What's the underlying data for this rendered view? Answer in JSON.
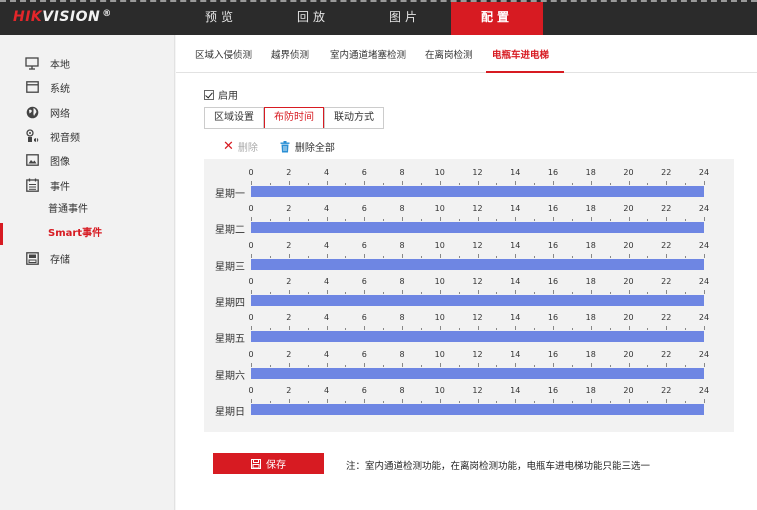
{
  "brand": {
    "part1": "HIK",
    "part2": "VISION",
    "reg": "®"
  },
  "topnav": [
    {
      "label": "预览",
      "active": false
    },
    {
      "label": "回放",
      "active": false
    },
    {
      "label": "图片",
      "active": false
    },
    {
      "label": "配置",
      "active": true
    }
  ],
  "sidebar": {
    "items": [
      {
        "label": "本地",
        "icon": "monitor-icon"
      },
      {
        "label": "系统",
        "icon": "system-icon"
      },
      {
        "label": "网络",
        "icon": "globe-icon"
      },
      {
        "label": "视音频",
        "icon": "camera-audio-icon"
      },
      {
        "label": "图像",
        "icon": "image-icon"
      },
      {
        "label": "事件",
        "icon": "calendar-icon"
      },
      {
        "label": "存储",
        "icon": "storage-icon"
      }
    ],
    "subitems": [
      {
        "label": "普通事件",
        "active": false
      },
      {
        "label": "Smart事件",
        "active": true
      }
    ]
  },
  "tabs": [
    {
      "label": "区域入侵侦测",
      "active": false
    },
    {
      "label": "越界侦测",
      "active": false
    },
    {
      "label": "室内通道堵塞检测",
      "active": false
    },
    {
      "label": "在离岗检测",
      "active": false
    },
    {
      "label": "电瓶车进电梯",
      "active": true
    }
  ],
  "enable": {
    "label": "启用",
    "checked": true
  },
  "subtabs": [
    {
      "label": "区域设置",
      "active": false
    },
    {
      "label": "布防时间",
      "active": true
    },
    {
      "label": "联动方式",
      "active": false
    }
  ],
  "actions": {
    "delete_label": "删除",
    "delete_all_label": "删除全部"
  },
  "schedule": {
    "ticks": [
      "0",
      "2",
      "4",
      "6",
      "8",
      "10",
      "12",
      "14",
      "16",
      "18",
      "20",
      "22",
      "24"
    ],
    "days": [
      {
        "label": "星期一",
        "start": 0,
        "end": 24
      },
      {
        "label": "星期二",
        "start": 0,
        "end": 24
      },
      {
        "label": "星期三",
        "start": 0,
        "end": 24
      },
      {
        "label": "星期四",
        "start": 0,
        "end": 24
      },
      {
        "label": "星期五",
        "start": 0,
        "end": 24
      },
      {
        "label": "星期六",
        "start": 0,
        "end": 24
      },
      {
        "label": "星期日",
        "start": 0,
        "end": 24
      }
    ],
    "bar_color": "#6e86e3"
  },
  "save_label": "保存",
  "note": "注：室内通道检测功能，在离岗检测功能，电瓶车进电梯功能只能三选一",
  "colors": {
    "accent": "#d71b22",
    "topbar": "#2b2b2b"
  }
}
